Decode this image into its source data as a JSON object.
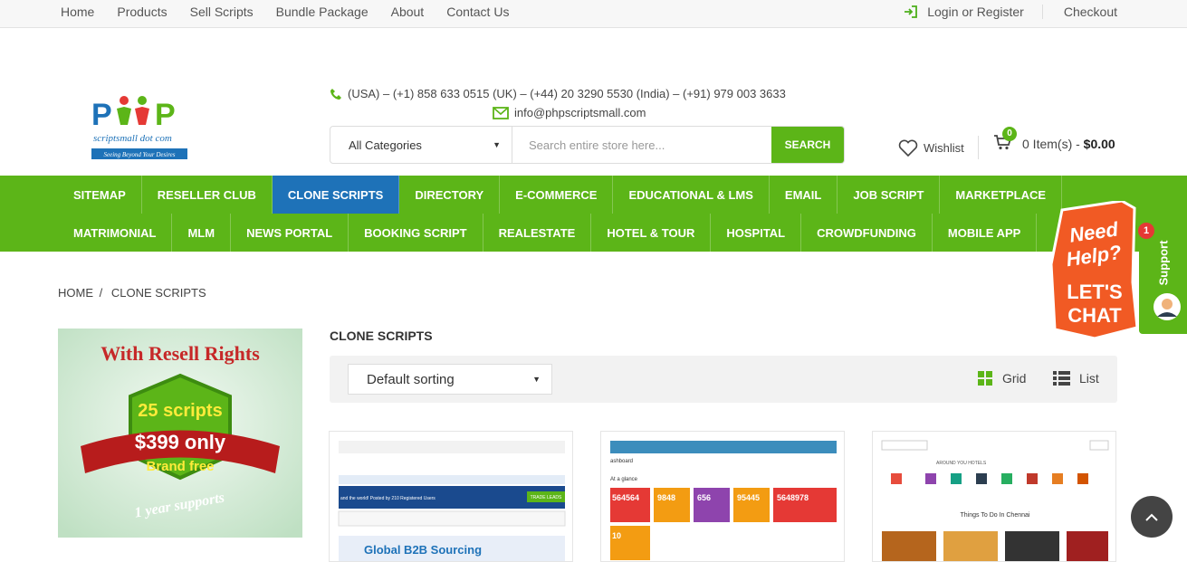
{
  "topbar": {
    "links": [
      "Home",
      "Products",
      "Sell Scripts",
      "Bundle Package",
      "About",
      "Contact Us"
    ],
    "login_label": "Login or Register",
    "checkout_label": "Checkout"
  },
  "logo": {
    "text_main": "PHP",
    "text_sub": "scriptsmall dot com",
    "tagline": "Seeing Beyond Your Desires"
  },
  "contact": {
    "phones": "(USA) – (+1) 858 633 0515 (UK) – (+44) 20 3290 5530 (India) – (+91) 979 003 3633",
    "email": "info@phpscriptsmall.com"
  },
  "search": {
    "category_selected": "All Categories",
    "placeholder": "Search entire store here...",
    "button_label": "SEARCH"
  },
  "wishlist_label": "Wishlist",
  "cart": {
    "count": "0",
    "items_text": "0 Item(s) - ",
    "total": "$0.00"
  },
  "nav": {
    "row1": [
      "SITEMAP",
      "RESELLER CLUB",
      "CLONE SCRIPTS",
      "DIRECTORY",
      "E-COMMERCE",
      "EDUCATIONAL & LMS",
      "EMAIL",
      "JOB SCRIPT",
      "MARKETPLACE"
    ],
    "row2": [
      "MATRIMONIAL",
      "MLM",
      "NEWS PORTAL",
      "BOOKING SCRIPT",
      "REALESTATE",
      "HOTEL & TOUR",
      "HOSPITAL",
      "CROWDFUNDING",
      "MOBILE APP"
    ],
    "active": "CLONE SCRIPTS"
  },
  "breadcrumb": {
    "home": "HOME",
    "separator": "/",
    "current": "CLONE SCRIPTS"
  },
  "banner": {
    "headline": "With Resell Rights",
    "scripts": "25 scripts",
    "price": "$399 only",
    "brand": "Brand free",
    "support": "1 year supports"
  },
  "section_title": "CLONE SCRIPTS",
  "toolbar": {
    "sort_selected": "Default sorting",
    "grid_label": "Grid",
    "list_label": "List"
  },
  "products": [
    {
      "caption": "Global B2B Sourcing",
      "banner": "and the world! Posted by 210 Registered Users",
      "button": "TRADE LEADS"
    },
    {
      "caption": "ashboard",
      "subcaption": "At a glance",
      "tiles": [
        "564564",
        "9848",
        "656",
        "95445",
        "5648978",
        "10"
      ]
    },
    {
      "caption": "Things To Do In Chennai",
      "subcaption": "AROUND YOU   HOTELS"
    }
  ],
  "chat": {
    "line1": "Need",
    "line2": "Help?",
    "line3": "LET'S",
    "line4": "CHAT",
    "badge": "1",
    "support_label": "Support"
  },
  "colors": {
    "brand_green": "#5cb518",
    "active_blue": "#1e72b8"
  }
}
